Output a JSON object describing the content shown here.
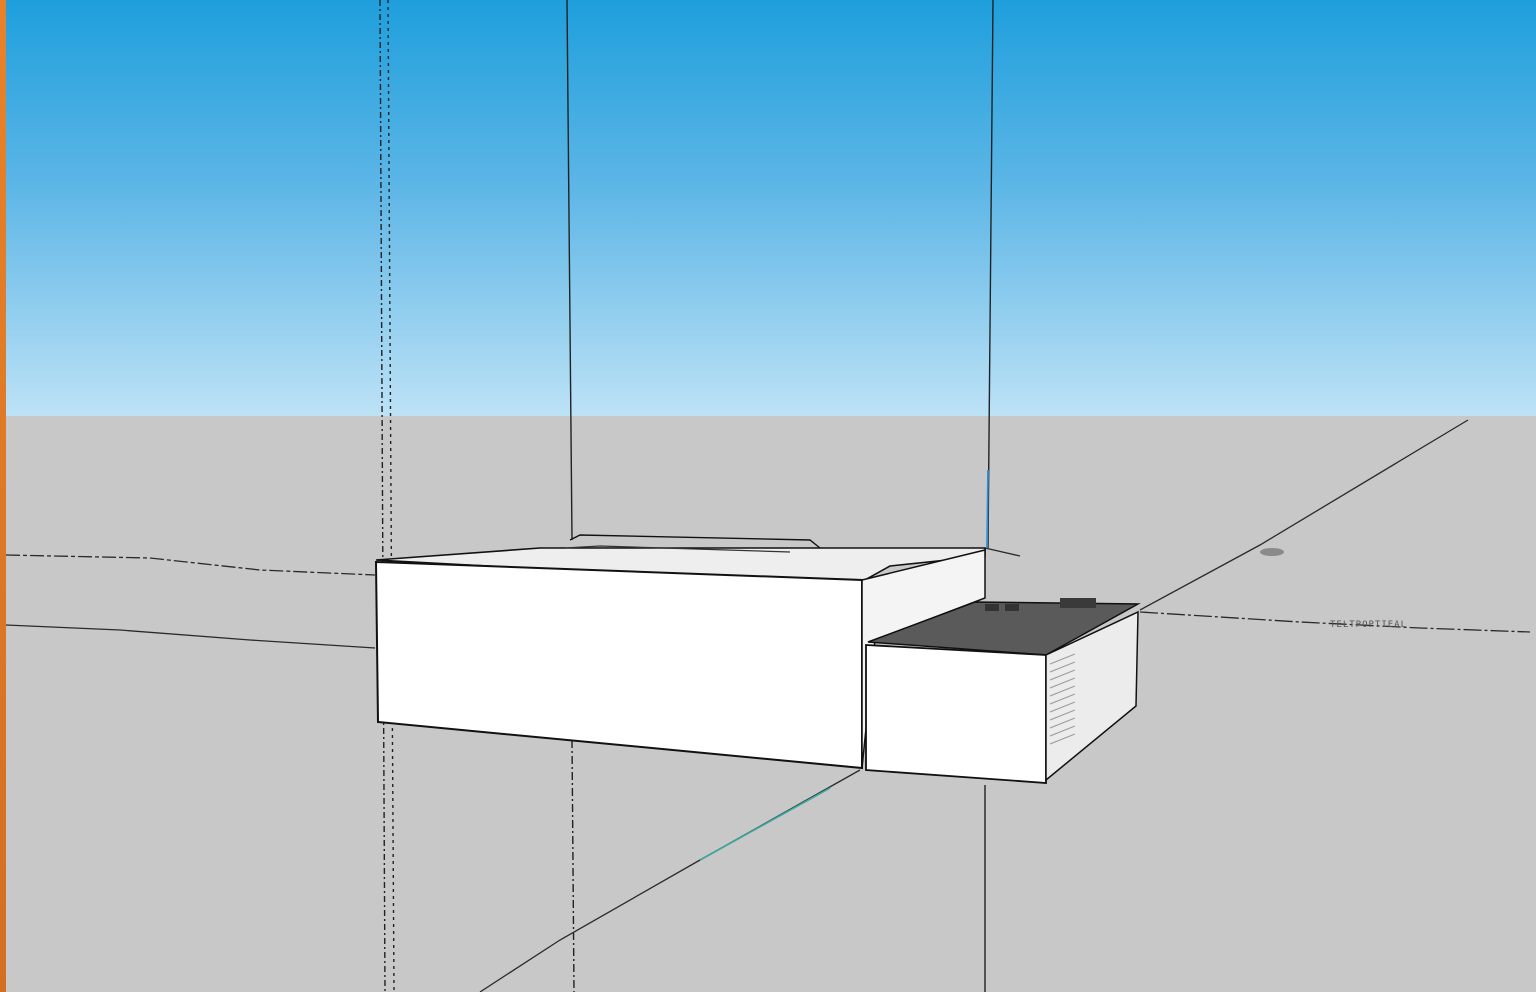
{
  "viewport": {
    "sky_top_color": "#1e9fdc",
    "sky_bottom_color": "#bde2f6",
    "ground_color": "#c8c8c9",
    "edge_color": "#e8822a"
  },
  "overlay_label": "TELTPOPTIEAL"
}
